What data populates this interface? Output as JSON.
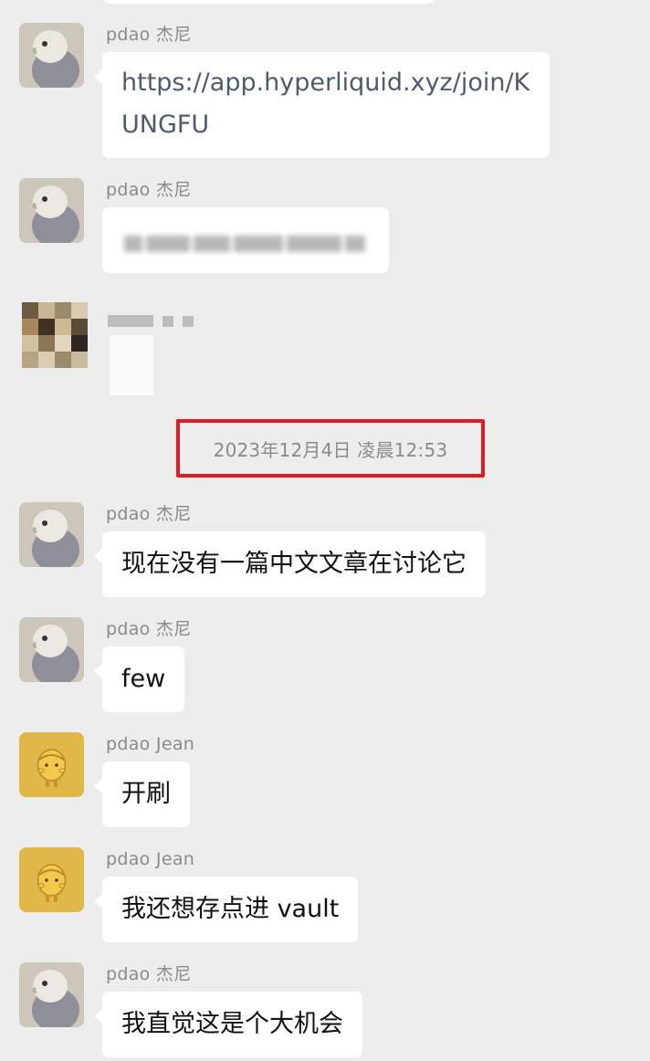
{
  "messages": [
    {
      "sender": "pdao 杰尼",
      "text": "https://app.hyperliquid.xyz/join/KUNGFU",
      "avatar_icon": "bird-avatar-icon"
    },
    {
      "sender": "pdao 杰尼",
      "text": "",
      "avatar_icon": "bird-avatar-icon"
    },
    {
      "sender": "",
      "text": "",
      "avatar_icon": "pixelated-avatar-icon"
    },
    {
      "sender": "pdao 杰尼",
      "text": "现在没有一篇中文文章在讨论它",
      "avatar_icon": "bird-avatar-icon"
    },
    {
      "sender": "pdao 杰尼",
      "text": "few",
      "avatar_icon": "bird-avatar-icon"
    },
    {
      "sender": "pdao Jean",
      "text": "开刷",
      "avatar_icon": "yellow-figure-avatar-icon"
    },
    {
      "sender": "pdao Jean",
      "text": "我还想存点进 vault",
      "avatar_icon": "yellow-figure-avatar-icon"
    },
    {
      "sender": "pdao 杰尼",
      "text": "我直觉这是个大机会",
      "avatar_icon": "bird-avatar-icon"
    }
  ],
  "timestamp": "2023年12月4日 凌晨12:53",
  "colors": {
    "background": "#ededed",
    "bubble": "#ffffff",
    "sender_text": "#8a8a8a",
    "link_text": "#4c5b6e",
    "highlight_border": "#e01b24",
    "yellow_avatar": "#e0b84a"
  }
}
